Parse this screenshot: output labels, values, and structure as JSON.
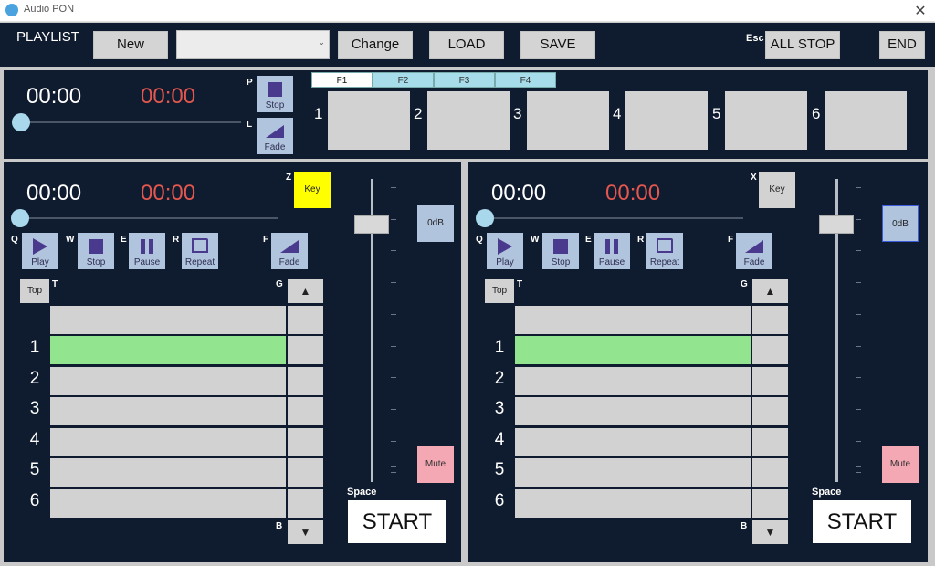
{
  "window": {
    "title": "Audio PON",
    "close_glyph": "✕"
  },
  "toolbar": {
    "playlist_label": "PLAYLIST",
    "new_label": "New",
    "combo_value": "",
    "change_label": "Change",
    "load_label": "LOAD",
    "save_label": "SAVE",
    "esc_key": "Esc",
    "all_stop_label": "ALL STOP",
    "end_label": "END"
  },
  "top_panel": {
    "elapsed": "00:00",
    "remaining": "00:00",
    "stop_key": "P",
    "stop_label": "Stop",
    "fade_key": "L",
    "fade_label": "Fade",
    "tabs": [
      "F1",
      "F2",
      "F3",
      "F4"
    ],
    "active_tab": "F1",
    "slot_numbers": [
      "1",
      "2",
      "3",
      "4",
      "5",
      "6"
    ]
  },
  "players": [
    {
      "elapsed": "00:00",
      "remaining": "00:00",
      "key_hotkey": "Z",
      "key_label": "Key",
      "key_active": true,
      "controls": [
        {
          "key": "Q",
          "label": "Play"
        },
        {
          "key": "W",
          "label": "Stop"
        },
        {
          "key": "E",
          "label": "Pause"
        },
        {
          "key": "R",
          "label": "Repeat"
        },
        {
          "key": "F",
          "label": "Fade"
        }
      ],
      "top_label": "Top",
      "top_key": "T",
      "g_key": "G",
      "b_key": "B",
      "up_glyph": "▲",
      "down_glyph": "▼",
      "rows": [
        "",
        "1",
        "2",
        "3",
        "4",
        "5",
        "6"
      ],
      "selected_row": "1",
      "odb_label": "0dB",
      "mute_label": "Mute",
      "space_key": "Space",
      "start_label": "START"
    },
    {
      "elapsed": "00:00",
      "remaining": "00:00",
      "key_hotkey": "X",
      "key_label": "Key",
      "key_active": false,
      "controls": [
        {
          "key": "Q",
          "label": "Play"
        },
        {
          "key": "W",
          "label": "Stop"
        },
        {
          "key": "E",
          "label": "Pause"
        },
        {
          "key": "R",
          "label": "Repeat"
        },
        {
          "key": "F",
          "label": "Fade"
        }
      ],
      "top_label": "Top",
      "top_key": "T",
      "g_key": "G",
      "b_key": "B",
      "up_glyph": "▲",
      "down_glyph": "▼",
      "rows": [
        "",
        "1",
        "2",
        "3",
        "4",
        "5",
        "6"
      ],
      "selected_row": "1",
      "odb_label": "0dB",
      "mute_label": "Mute",
      "space_key": "Space",
      "start_label": "START"
    }
  ],
  "colors": {
    "panel_bg": "#0f1b2e",
    "remaining_time": "#e4574e",
    "key_active": "#ffff00",
    "selected_row": "#92e58e",
    "mute": "#f3a8b3"
  }
}
